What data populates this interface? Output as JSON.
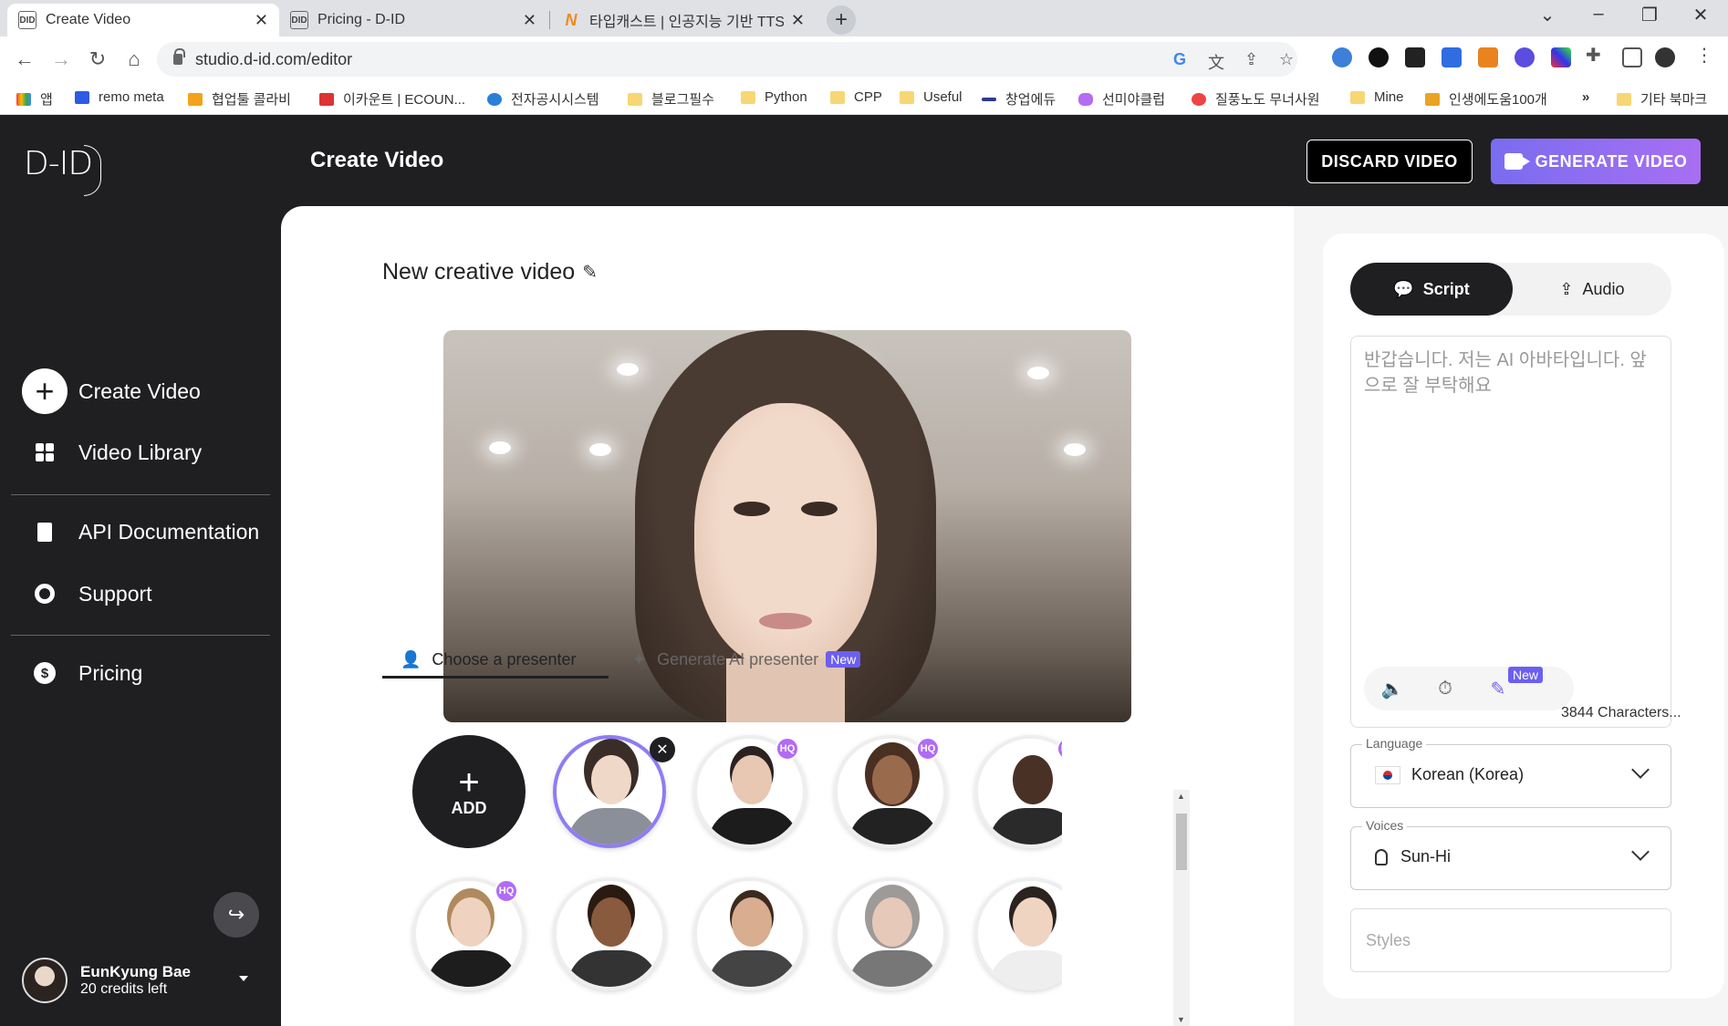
{
  "browser": {
    "tabs": [
      {
        "title": "Create Video",
        "favicon": "D-ID",
        "active": true
      },
      {
        "title": "Pricing - D-ID",
        "favicon": "D-ID",
        "active": false
      },
      {
        "title": "타입캐스트 | 인공지능 기반 TTS",
        "favicon": "N",
        "active": false
      }
    ],
    "url": "studio.d-id.com/editor",
    "bookmarks": [
      {
        "label": "앱",
        "icon": "apps-grid-icon"
      },
      {
        "label": "remo meta",
        "icon": "remo-icon"
      },
      {
        "label": "협업툴 콜라비",
        "icon": "collabee-icon"
      },
      {
        "label": "이카운트 | ECOUN...",
        "icon": "ecount-icon"
      },
      {
        "label": "전자공시시스템",
        "icon": "dart-icon"
      },
      {
        "label": "블로그필수",
        "icon": "folder-icon"
      },
      {
        "label": "Python",
        "icon": "folder-icon"
      },
      {
        "label": "CPP",
        "icon": "folder-icon"
      },
      {
        "label": "Useful",
        "icon": "folder-icon"
      },
      {
        "label": "창업에듀",
        "icon": "startup-edu-icon"
      },
      {
        "label": "선미야클럽",
        "icon": "sunmiya-icon"
      },
      {
        "label": "질풍노도 무너사원",
        "icon": "character-icon"
      },
      {
        "label": "Mine",
        "icon": "folder-icon"
      },
      {
        "label": "인생에도움100개",
        "icon": "trophy-icon"
      },
      {
        "label": "»",
        "icon": "more-icon"
      },
      {
        "label": "기타 북마크",
        "icon": "folder-icon"
      }
    ]
  },
  "sidebar": {
    "logo": "D-ID",
    "items": [
      {
        "label": "Create Video",
        "icon": "plus-circle-icon"
      },
      {
        "label": "Video Library",
        "icon": "grid-icon"
      },
      {
        "label": "API Documentation",
        "icon": "document-icon"
      },
      {
        "label": "Support",
        "icon": "lifebuoy-icon"
      },
      {
        "label": "Pricing",
        "icon": "dollar-icon"
      }
    ],
    "user": {
      "name": "EunKyung Bae",
      "credits": "20 credits left"
    }
  },
  "header": {
    "title": "Create Video",
    "discard_label": "DISCARD VIDEO",
    "generate_label": "GENERATE VIDEO",
    "accent": "#8b6ff2"
  },
  "editor": {
    "video_title": "New creative video",
    "presenter_tabs": [
      {
        "label": "Choose a presenter",
        "active": true
      },
      {
        "label": "Generate AI presenter",
        "badge": "New",
        "active": false
      }
    ],
    "add_label": "ADD",
    "hq_badge": "HQ",
    "presenters": [
      {
        "name": "custom-presenter",
        "selected": true,
        "hq": false,
        "removable": true
      },
      {
        "name": "presenter-man-1",
        "selected": false,
        "hq": true
      },
      {
        "name": "presenter-woman-1",
        "selected": false,
        "hq": true
      },
      {
        "name": "presenter-man-2",
        "selected": false,
        "hq": true
      },
      {
        "name": "presenter-woman-2",
        "selected": false,
        "hq": true
      },
      {
        "name": "presenter-woman-3",
        "selected": false,
        "hq": false
      },
      {
        "name": "presenter-man-3",
        "selected": false,
        "hq": false
      },
      {
        "name": "presenter-woman-4",
        "selected": false,
        "hq": false
      },
      {
        "name": "presenter-woman-5",
        "selected": false,
        "hq": false
      }
    ]
  },
  "panel": {
    "tabs": {
      "script": "Script",
      "audio": "Audio"
    },
    "script_placeholder": "반갑습니다. 저는 AI 아바타입니다. 앞으로 잘 부탁해요",
    "tool_badge": "New",
    "characters": "3844 Characters...",
    "language": {
      "label": "Language",
      "value": "Korean (Korea)"
    },
    "voices": {
      "label": "Voices",
      "value": "Sun-Hi"
    },
    "styles_placeholder": "Styles"
  }
}
